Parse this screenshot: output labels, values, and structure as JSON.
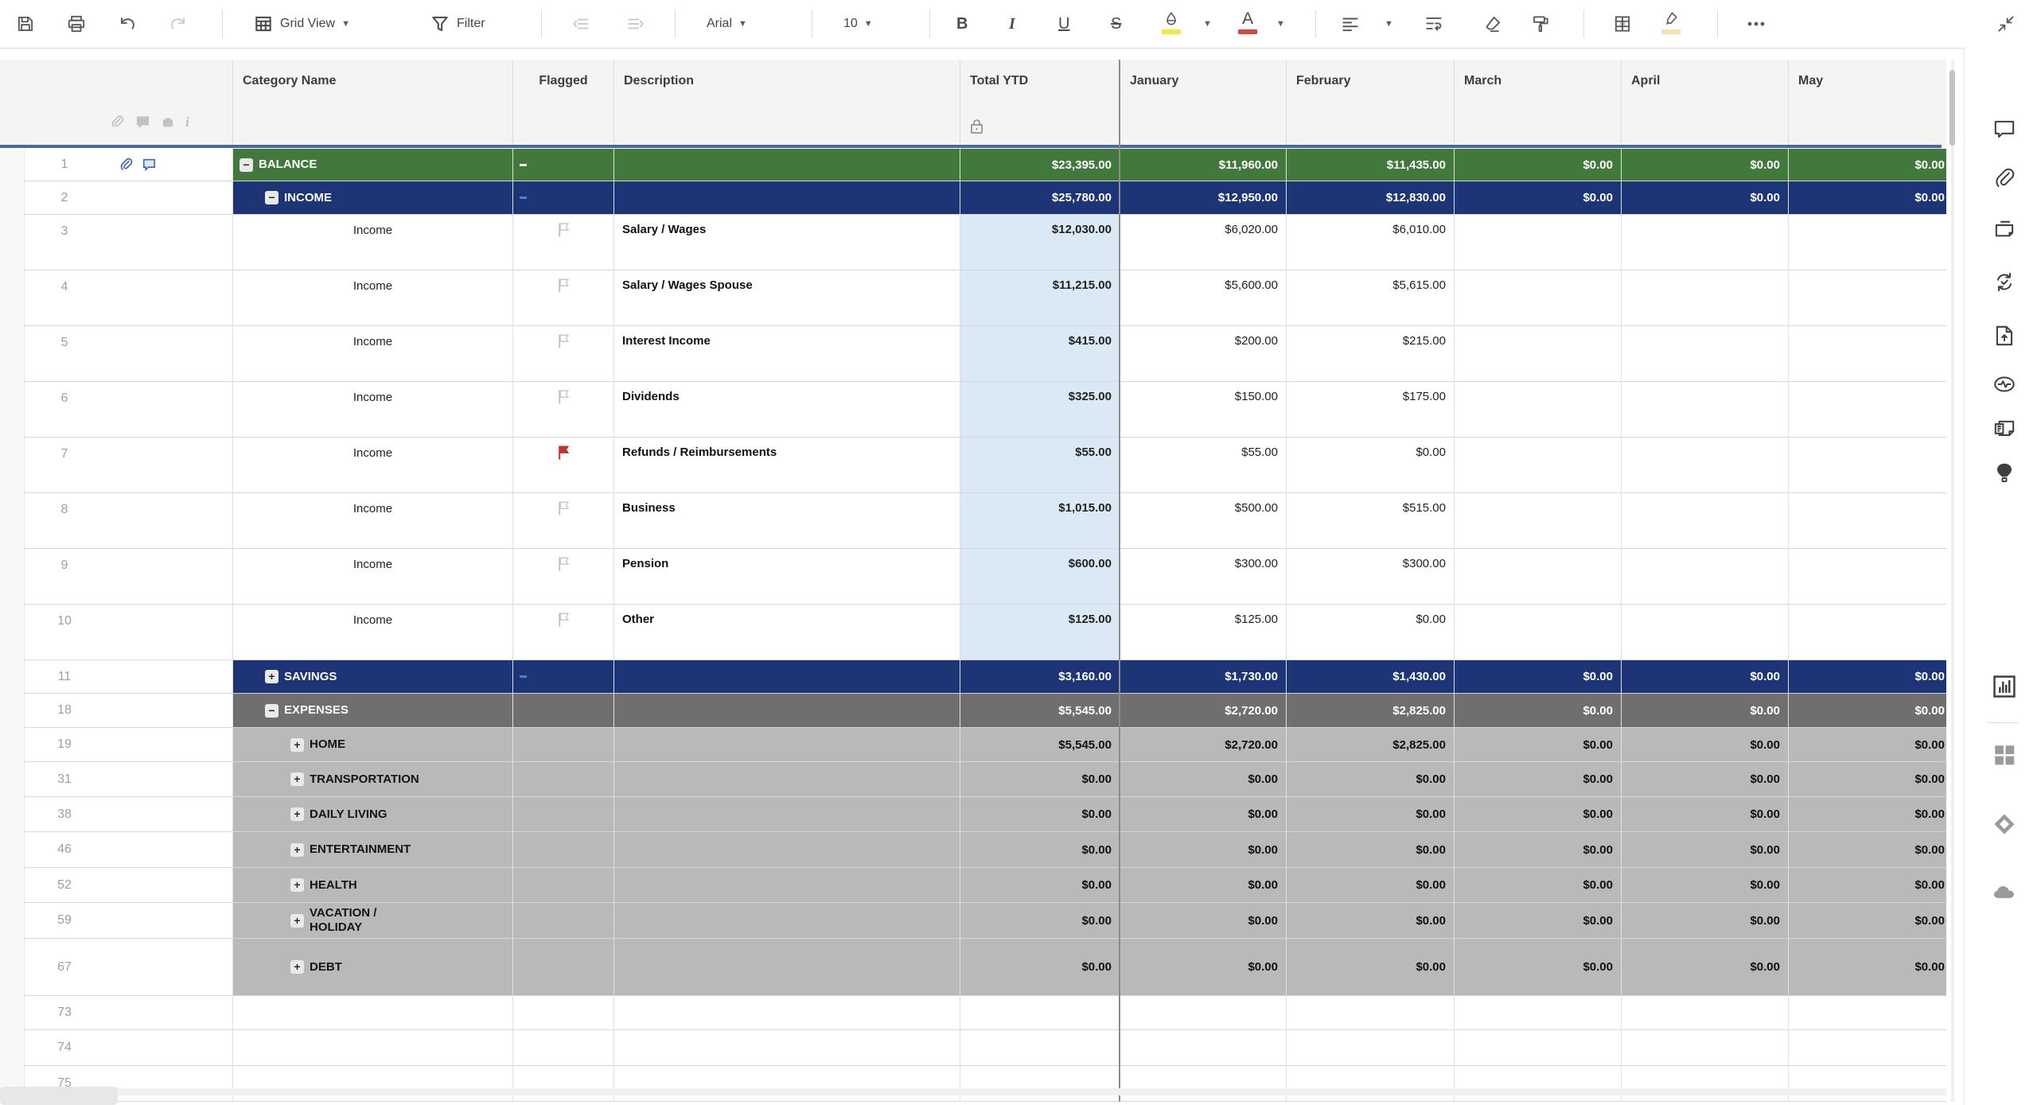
{
  "toolbar": {
    "view_label": "Grid View",
    "filter_label": "Filter",
    "font_name": "Arial",
    "font_size": "10",
    "bold_label": "B",
    "italic_label": "I",
    "underline_label": "U",
    "strike_label": "S",
    "color_label": "A"
  },
  "colors": {
    "green": "#41793c",
    "navy": "#1d3576",
    "gray": "#6f6f6f",
    "lightgray": "#b9b9b9",
    "ytd_tint": "#dbe9f7",
    "header_line": "#4a6a9e",
    "accent_blue": "#3b68b1",
    "dash_blue": "#4d7fd1",
    "flag_red": "#bf3331",
    "flag_gray": "#c4c4c4",
    "fill_swatch": "#f3e73e",
    "text_swatch": "#d8453c",
    "highlight_swatch": "#f6e2ae"
  },
  "columns": [
    {
      "label": "Category Name"
    },
    {
      "label": "Flagged",
      "align": "center"
    },
    {
      "label": "Description"
    },
    {
      "label": "Total YTD",
      "locked": true
    },
    {
      "label": "January"
    },
    {
      "label": "February"
    },
    {
      "label": "March"
    },
    {
      "label": "April"
    },
    {
      "label": "May"
    }
  ],
  "rows": [
    {
      "num": "1",
      "kind": "section",
      "level": 0,
      "toggle": "minus",
      "name": "BALANCE",
      "dash": "white",
      "bg": "green",
      "attach": true,
      "comment": true,
      "values": [
        "$23,395.00",
        "$11,960.00",
        "$11,435.00",
        "$0.00",
        "$0.00",
        "$0.00"
      ]
    },
    {
      "num": "2",
      "kind": "section",
      "level": 1,
      "toggle": "minus",
      "name": "INCOME",
      "dash": "blue",
      "bg": "navy",
      "values": [
        "$25,780.00",
        "$12,950.00",
        "$12,830.00",
        "$0.00",
        "$0.00",
        "$0.00"
      ]
    },
    {
      "num": "3",
      "kind": "item",
      "category": "Income",
      "flag": "outline",
      "desc": "Salary / Wages",
      "values": [
        "$12,030.00",
        "$6,020.00",
        "$6,010.00",
        "",
        "",
        ""
      ]
    },
    {
      "num": "4",
      "kind": "item",
      "category": "Income",
      "flag": "outline",
      "desc": "Salary / Wages Spouse",
      "values": [
        "$11,215.00",
        "$5,600.00",
        "$5,615.00",
        "",
        "",
        ""
      ]
    },
    {
      "num": "5",
      "kind": "item",
      "category": "Income",
      "flag": "outline",
      "desc": "Interest Income",
      "values": [
        "$415.00",
        "$200.00",
        "$215.00",
        "",
        "",
        ""
      ]
    },
    {
      "num": "6",
      "kind": "item",
      "category": "Income",
      "flag": "outline",
      "desc": "Dividends",
      "values": [
        "$325.00",
        "$150.00",
        "$175.00",
        "",
        "",
        ""
      ]
    },
    {
      "num": "7",
      "kind": "item",
      "category": "Income",
      "flag": "red",
      "desc": "Refunds / Reimbursements",
      "values": [
        "$55.00",
        "$55.00",
        "$0.00",
        "",
        "",
        ""
      ]
    },
    {
      "num": "8",
      "kind": "item",
      "category": "Income",
      "flag": "outline",
      "desc": "Business",
      "values": [
        "$1,015.00",
        "$500.00",
        "$515.00",
        "",
        "",
        ""
      ]
    },
    {
      "num": "9",
      "kind": "item",
      "category": "Income",
      "flag": "outline",
      "desc": "Pension",
      "values": [
        "$600.00",
        "$300.00",
        "$300.00",
        "",
        "",
        ""
      ]
    },
    {
      "num": "10",
      "kind": "item",
      "category": "Income",
      "flag": "outline",
      "desc": "Other",
      "values": [
        "$125.00",
        "$125.00",
        "$0.00",
        "",
        "",
        ""
      ]
    },
    {
      "num": "11",
      "kind": "section",
      "level": 1,
      "toggle": "plus",
      "name": "SAVINGS",
      "dash": "blue",
      "bg": "navy",
      "values": [
        "$3,160.00",
        "$1,730.00",
        "$1,430.00",
        "$0.00",
        "$0.00",
        "$0.00"
      ]
    },
    {
      "num": "18",
      "kind": "section",
      "level": 1,
      "toggle": "minus",
      "name": "EXPENSES",
      "bg": "gray",
      "values": [
        "$5,545.00",
        "$2,720.00",
        "$2,825.00",
        "$0.00",
        "$0.00",
        "$0.00"
      ]
    },
    {
      "num": "19",
      "kind": "section",
      "level": 2,
      "toggle": "plus",
      "name": "HOME",
      "bg": "lightgray",
      "values": [
        "$5,545.00",
        "$2,720.00",
        "$2,825.00",
        "$0.00",
        "$0.00",
        "$0.00"
      ]
    },
    {
      "num": "31",
      "kind": "section",
      "level": 2,
      "toggle": "plus",
      "name": "TRANSPORTATION",
      "bg": "lightgray",
      "values": [
        "$0.00",
        "$0.00",
        "$0.00",
        "$0.00",
        "$0.00",
        "$0.00"
      ]
    },
    {
      "num": "38",
      "kind": "section",
      "level": 2,
      "toggle": "plus",
      "name": "DAILY LIVING",
      "bg": "lightgray",
      "values": [
        "$0.00",
        "$0.00",
        "$0.00",
        "$0.00",
        "$0.00",
        "$0.00"
      ]
    },
    {
      "num": "46",
      "kind": "section",
      "level": 2,
      "toggle": "plus",
      "name": "ENTERTAINMENT",
      "bg": "lightgray",
      "values": [
        "$0.00",
        "$0.00",
        "$0.00",
        "$0.00",
        "$0.00",
        "$0.00"
      ]
    },
    {
      "num": "52",
      "kind": "section",
      "level": 2,
      "toggle": "plus",
      "name": "HEALTH",
      "bg": "lightgray",
      "values": [
        "$0.00",
        "$0.00",
        "$0.00",
        "$0.00",
        "$0.00",
        "$0.00"
      ]
    },
    {
      "num": "59",
      "kind": "section",
      "level": 2,
      "toggle": "plus",
      "name": "VACATION / HOLIDAY",
      "wrap": true,
      "bg": "lightgray",
      "values": [
        "$0.00",
        "$0.00",
        "$0.00",
        "$0.00",
        "$0.00",
        "$0.00"
      ]
    },
    {
      "num": "67",
      "kind": "section",
      "level": 2,
      "toggle": "plus",
      "name": "DEBT",
      "bg": "lightgray",
      "values": [
        "$0.00",
        "$0.00",
        "$0.00",
        "$0.00",
        "$0.00",
        "$0.00"
      ]
    },
    {
      "num": "73",
      "kind": "empty",
      "values": [
        "",
        "",
        "",
        "",
        "",
        ""
      ]
    },
    {
      "num": "74",
      "kind": "empty",
      "values": [
        "",
        "",
        "",
        "",
        "",
        ""
      ]
    },
    {
      "num": "75",
      "kind": "empty",
      "values": [
        "",
        "",
        "",
        "",
        "",
        ""
      ]
    }
  ]
}
